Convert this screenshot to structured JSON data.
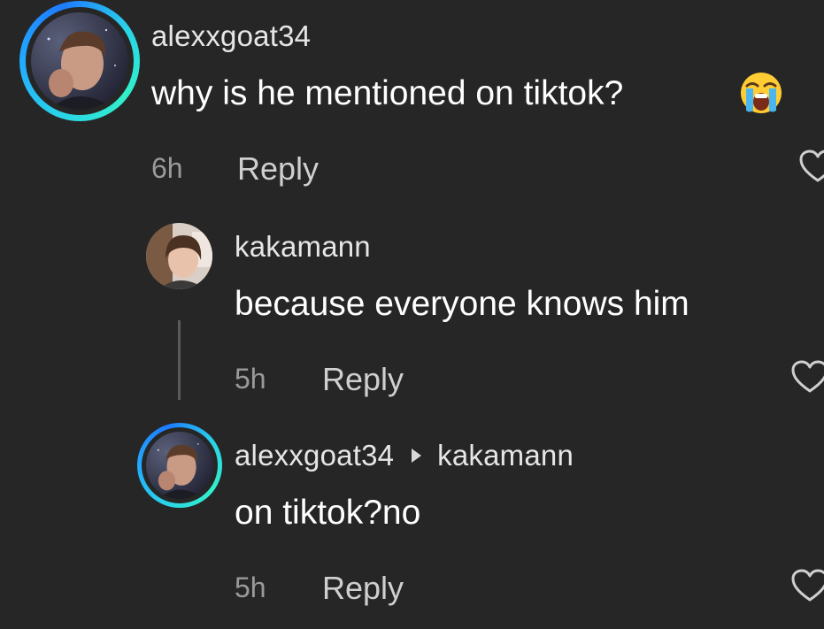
{
  "comments": [
    {
      "username": "alexxgoat34",
      "text": "why is he mentioned on tiktok?",
      "emoji": "loudly-crying-face",
      "time": "6h",
      "reply_label": "Reply"
    },
    {
      "username": "kakamann",
      "text": "because everyone knows him",
      "time": "5h",
      "reply_label": "Reply"
    },
    {
      "username": "alexxgoat34",
      "reply_to": "kakamann",
      "text": "on tiktok?no",
      "time": "5h",
      "reply_label": "Reply"
    }
  ],
  "icons": {
    "like": "heart-outline-icon",
    "reply_arrow": "triangle-right-icon"
  },
  "colors": {
    "background": "#262626",
    "avatar_ring_start": "#2ad4e8",
    "avatar_ring_end": "#1e7bff",
    "secondary_text": "#9a9a9a"
  }
}
